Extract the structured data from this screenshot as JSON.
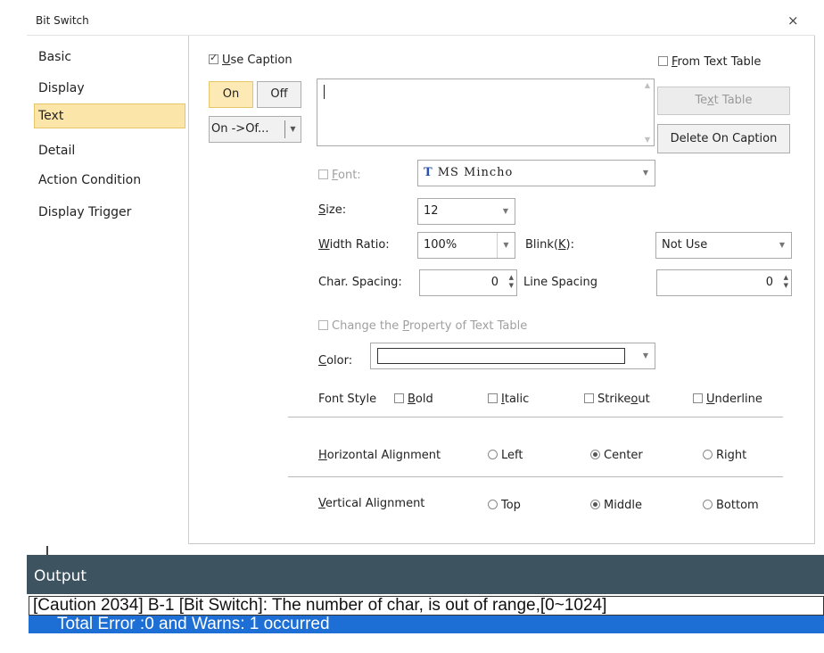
{
  "dialog": {
    "title": "Bit Switch",
    "close": "×"
  },
  "nav": {
    "items": [
      "Basic",
      "Display",
      "Text",
      "Detail",
      "Action Condition",
      "Display Trigger"
    ],
    "selected_index": 2
  },
  "caption": {
    "use_caption_pre": "",
    "use_caption_u": "U",
    "use_caption_post": "se Caption",
    "from_text_table_u": "F",
    "from_text_table_post": "rom Text Table",
    "on_label": "On",
    "off_label": "Off",
    "state_combo": "On ->Of...",
    "text_value": "",
    "text_table_pre": "Te",
    "text_table_u": "x",
    "text_table_post": "t Table",
    "delete_on_caption": "Delete On Caption"
  },
  "font": {
    "label_u": "F",
    "label_post": "ont:",
    "font_icon": "T",
    "font_value": "MS Mincho",
    "size_label_u": "S",
    "size_label_post": "ize:",
    "size_value": "12",
    "width_ratio_label_u": "W",
    "width_ratio_label_post": "idth Ratio:",
    "width_ratio_value": "100%",
    "blink_label_pre": "Blink(",
    "blink_label_u": "K",
    "blink_label_post": "):",
    "blink_value": "Not Use",
    "char_spacing_label": "Char. Spacing:",
    "char_spacing_value": "0",
    "line_spacing_label": "Line Spacing",
    "line_spacing_value": "0",
    "change_property_pre": "Change the ",
    "change_property_u": "P",
    "change_property_post": "roperty of Text Table",
    "color_label_u": "C",
    "color_label_post": "olor:"
  },
  "style": {
    "label": "Font Style",
    "bold_u": "B",
    "bold_post": "old",
    "italic_u": "I",
    "italic_post": "talic",
    "strike_pre": "Strike",
    "strike_u": "o",
    "strike_post": "ut",
    "underline_u": "U",
    "underline_post": "nderline"
  },
  "halign": {
    "label_u": "H",
    "label_post": "orizontal Alignment",
    "options": [
      "Left",
      "Center",
      "Right"
    ],
    "selected": "Center"
  },
  "valign": {
    "label_u": "V",
    "label_post": "ertical Alignment",
    "options": [
      "Top",
      "Middle",
      "Bottom"
    ],
    "selected": "Middle"
  },
  "output": {
    "title": "Output",
    "lines": [
      "[Caution 2034] B-1 [Bit Switch]: The number of char, is out of range,[0~1024]",
      "Total Error :0 and Warns: 1 occurred"
    ]
  },
  "colors": {
    "nav_selected": "#fce5a8",
    "output_header": "#3d5360",
    "output_selected": "#1d6fd6"
  }
}
